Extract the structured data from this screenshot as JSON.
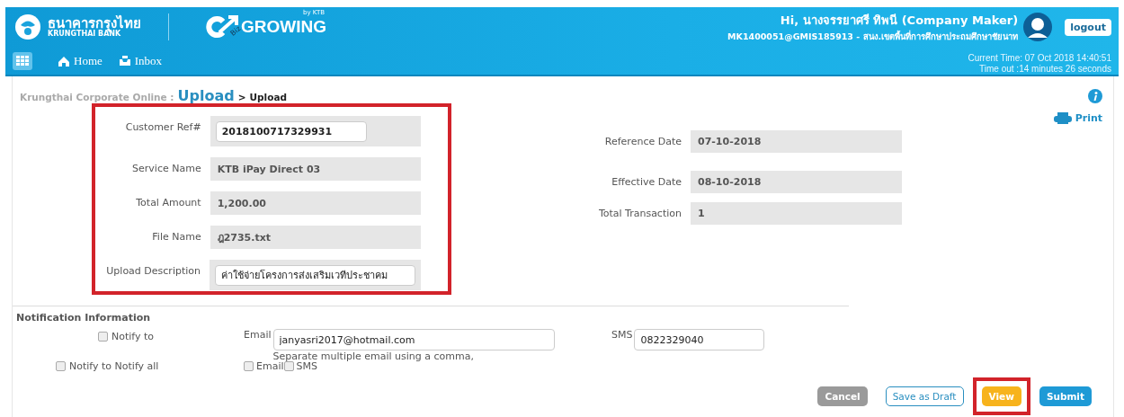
{
  "header": {
    "bank_name_thai": "ธนาคารกรุงไทย",
    "bank_name_english": "KRUNGTHAI BANK",
    "product_logo": {
      "badge": "Biz",
      "name": "GROWING",
      "byline": "by KTB"
    },
    "greeting": "Hi, นางจรรยาศรี ทิพนี (Company Maker)",
    "account": "MK1400051@GMIS185913 - สนง.เขตพื้นที่การศึกษาประถมศึกษาชัยนาท",
    "logout": "logout",
    "nav": [
      {
        "label": "Home"
      },
      {
        "label": "Inbox"
      }
    ],
    "current_time": "Current Time: 07 Oct 2018 14:40:51",
    "timeout": "Time out :14 minutes 26 seconds"
  },
  "breadcrumb": {
    "root": "Krungthai Corporate Online :",
    "section": "Upload",
    "separator": ">",
    "page": "Upload"
  },
  "print": "Print",
  "fields_left": {
    "highlighted": true,
    "items": [
      {
        "label": "Customer Ref#",
        "value": "2018100717329931",
        "kind": "input"
      },
      {
        "label": "Service Name",
        "value": "KTB iPay Direct 03",
        "kind": "readonly"
      },
      {
        "label": "Total Amount",
        "value": "1,200.00",
        "kind": "readonly"
      },
      {
        "label": "File Name",
        "value": "ฎ2735.txt",
        "kind": "readonly"
      },
      {
        "label": "Upload Description",
        "value": "ค่าใช้จ่ายโครงการส่งเสริมเวทีประชาคม",
        "kind": "input"
      }
    ]
  },
  "fields_right": [
    {
      "label": "Reference Date",
      "value": "07-10-2018",
      "kind": "readonly"
    },
    {
      "label": "Effective Date",
      "value": "08-10-2018",
      "kind": "readonly"
    },
    {
      "label": "Total Transaction",
      "value": "1",
      "kind": "readonly"
    }
  ],
  "notification": {
    "title": "Notification Information",
    "notify_to": {
      "label": "Notify to",
      "checked": false
    },
    "email_label": "Email",
    "email_value": "janyasri2017@hotmail.com",
    "email_hint": "Separate multiple email using a comma,",
    "sms_label": "SMS",
    "sms_value": "0822329040",
    "notify_all": {
      "label": "Notify to Notify all",
      "checked": false
    },
    "channels": [
      {
        "label": "Email",
        "checked": false
      },
      {
        "label": "SMS",
        "checked": false
      }
    ]
  },
  "buttons": [
    {
      "label": "Cancel",
      "kind": "cancel",
      "highlighted": false
    },
    {
      "label": "Save as Draft",
      "kind": "outline",
      "highlighted": false
    },
    {
      "label": "View",
      "kind": "warning",
      "highlighted": true
    },
    {
      "label": "Submit",
      "kind": "primary",
      "highlighted": false
    }
  ]
}
